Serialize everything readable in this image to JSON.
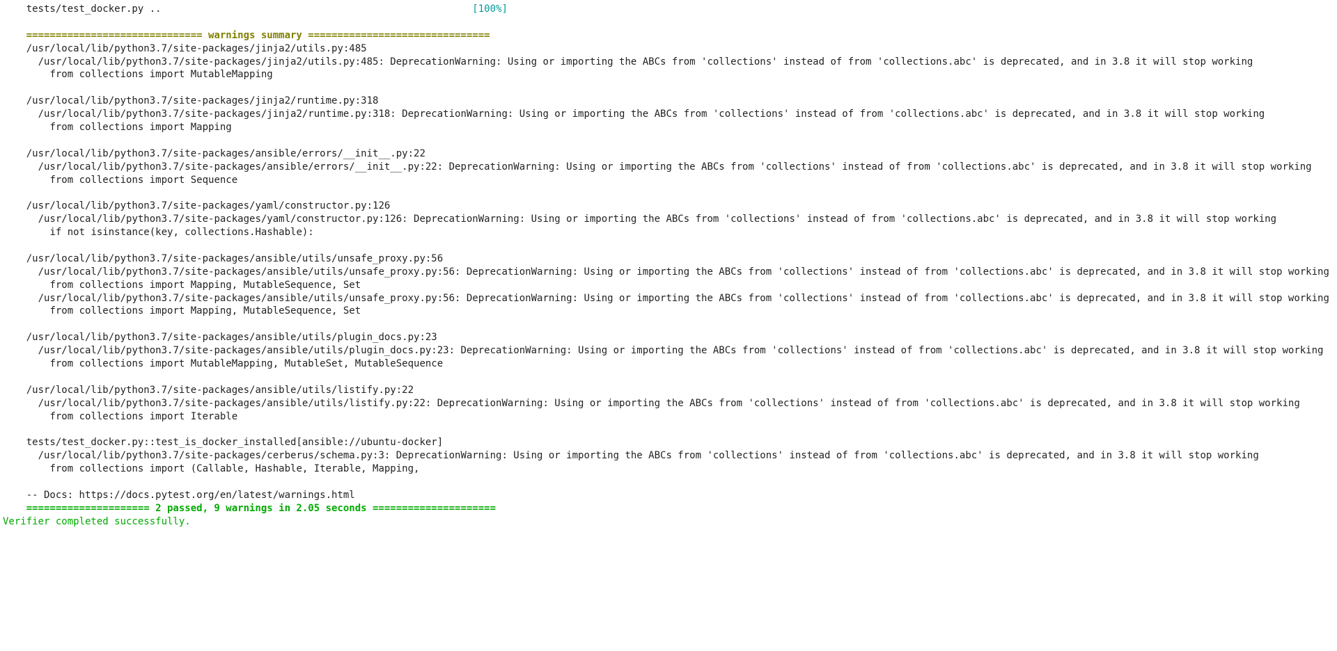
{
  "progress": {
    "label": "tests/test_docker.py ..",
    "percent": "[100%]"
  },
  "warnings_header": {
    "left_rule": "============================== ",
    "title": "warnings summary",
    "right_rule": " ==============================="
  },
  "warnings": [
    {
      "header": "/usr/local/lib/python3.7/site-packages/jinja2/utils.py:485",
      "lines": [
        "  /usr/local/lib/python3.7/site-packages/jinja2/utils.py:485: DeprecationWarning: Using or importing the ABCs from 'collections' instead of from 'collections.abc' is deprecated, and in 3.8 it will stop working",
        "    from collections import MutableMapping"
      ]
    },
    {
      "header": "/usr/local/lib/python3.7/site-packages/jinja2/runtime.py:318",
      "lines": [
        "  /usr/local/lib/python3.7/site-packages/jinja2/runtime.py:318: DeprecationWarning: Using or importing the ABCs from 'collections' instead of from 'collections.abc' is deprecated, and in 3.8 it will stop working",
        "    from collections import Mapping"
      ]
    },
    {
      "header": "/usr/local/lib/python3.7/site-packages/ansible/errors/__init__.py:22",
      "lines": [
        "  /usr/local/lib/python3.7/site-packages/ansible/errors/__init__.py:22: DeprecationWarning: Using or importing the ABCs from 'collections' instead of from 'collections.abc' is deprecated, and in 3.8 it will stop working",
        "    from collections import Sequence"
      ]
    },
    {
      "header": "/usr/local/lib/python3.7/site-packages/yaml/constructor.py:126",
      "lines": [
        "  /usr/local/lib/python3.7/site-packages/yaml/constructor.py:126: DeprecationWarning: Using or importing the ABCs from 'collections' instead of from 'collections.abc' is deprecated, and in 3.8 it will stop working",
        "    if not isinstance(key, collections.Hashable):"
      ]
    },
    {
      "header": "/usr/local/lib/python3.7/site-packages/ansible/utils/unsafe_proxy.py:56",
      "lines": [
        "  /usr/local/lib/python3.7/site-packages/ansible/utils/unsafe_proxy.py:56: DeprecationWarning: Using or importing the ABCs from 'collections' instead of from 'collections.abc' is deprecated, and in 3.8 it will stop working",
        "    from collections import Mapping, MutableSequence, Set",
        "  /usr/local/lib/python3.7/site-packages/ansible/utils/unsafe_proxy.py:56: DeprecationWarning: Using or importing the ABCs from 'collections' instead of from 'collections.abc' is deprecated, and in 3.8 it will stop working",
        "    from collections import Mapping, MutableSequence, Set"
      ]
    },
    {
      "header": "/usr/local/lib/python3.7/site-packages/ansible/utils/plugin_docs.py:23",
      "lines": [
        "  /usr/local/lib/python3.7/site-packages/ansible/utils/plugin_docs.py:23: DeprecationWarning: Using or importing the ABCs from 'collections' instead of from 'collections.abc' is deprecated, and in 3.8 it will stop working",
        "    from collections import MutableMapping, MutableSet, MutableSequence"
      ]
    },
    {
      "header": "/usr/local/lib/python3.7/site-packages/ansible/utils/listify.py:22",
      "lines": [
        "  /usr/local/lib/python3.7/site-packages/ansible/utils/listify.py:22: DeprecationWarning: Using or importing the ABCs from 'collections' instead of from 'collections.abc' is deprecated, and in 3.8 it will stop working",
        "    from collections import Iterable"
      ]
    },
    {
      "header": "tests/test_docker.py::test_is_docker_installed[ansible://ubuntu-docker]",
      "lines": [
        "  /usr/local/lib/python3.7/site-packages/cerberus/schema.py:3: DeprecationWarning: Using or importing the ABCs from 'collections' instead of from 'collections.abc' is deprecated, and in 3.8 it will stop working",
        "    from collections import (Callable, Hashable, Iterable, Mapping,"
      ]
    }
  ],
  "docs_line": "-- Docs: https://docs.pytest.org/en/latest/warnings.html",
  "result": {
    "left_rule": "===================== ",
    "text": "2 passed, 9 warnings in 2.05 seconds",
    "right_rule": " ====================="
  },
  "verifier": "Verifier completed successfully."
}
